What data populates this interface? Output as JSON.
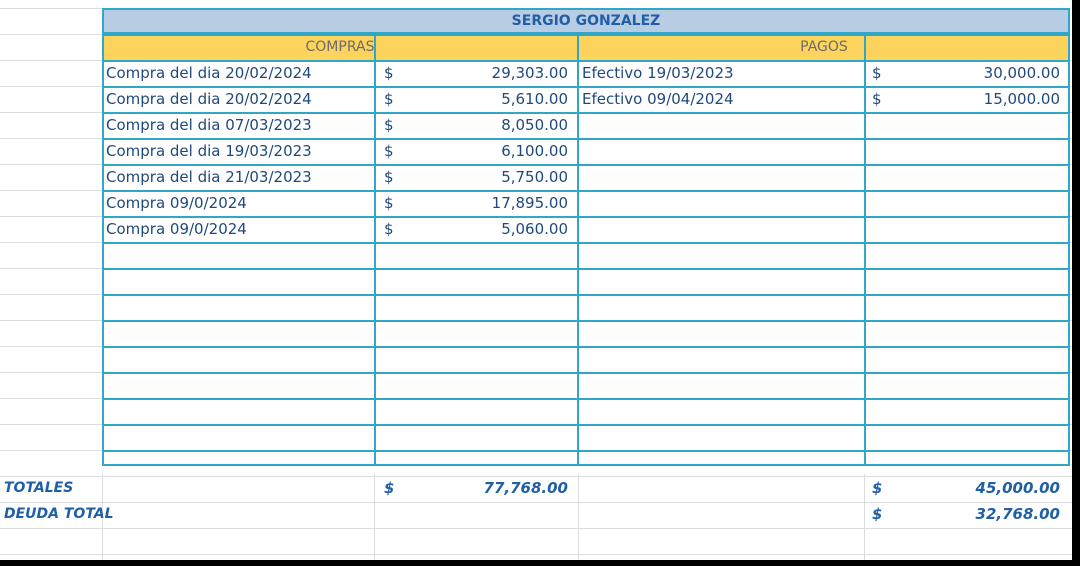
{
  "sheet": {
    "title": "SERGIO GONZALEZ",
    "compras_header": "COMPRAS",
    "pagos_header": "PAGOS",
    "currency": "$",
    "compras": [
      {
        "desc": "Compra del dia 20/02/2024",
        "amount": "29,303.00"
      },
      {
        "desc": "Compra del dia 20/02/2024",
        "amount": "5,610.00"
      },
      {
        "desc": "Compra del dia 07/03/2023",
        "amount": "8,050.00"
      },
      {
        "desc": "Compra del dia 19/03/2023",
        "amount": "6,100.00"
      },
      {
        "desc": "Compra del dia 21/03/2023",
        "amount": "5,750.00"
      },
      {
        "desc": "Compra 09/0/2024",
        "amount": "17,895.00"
      },
      {
        "desc": "Compra 09/0/2024",
        "amount": "5,060.00"
      }
    ],
    "pagos": [
      {
        "desc": "Efectivo 19/03/2023",
        "amount": "30,000.00"
      },
      {
        "desc": "Efectivo 09/04/2024",
        "amount": "15,000.00"
      }
    ],
    "totales_label": "TOTALES",
    "total_compras": "77,768.00",
    "total_pagos": "45,000.00",
    "deuda_label": "DEUDA TOTAL",
    "deuda_total": "32,768.00"
  },
  "colors": {
    "title_bg": "#b8cce4",
    "header_bg": "#fcd35d",
    "border": "#31a7c7",
    "text": "#1f497d"
  }
}
